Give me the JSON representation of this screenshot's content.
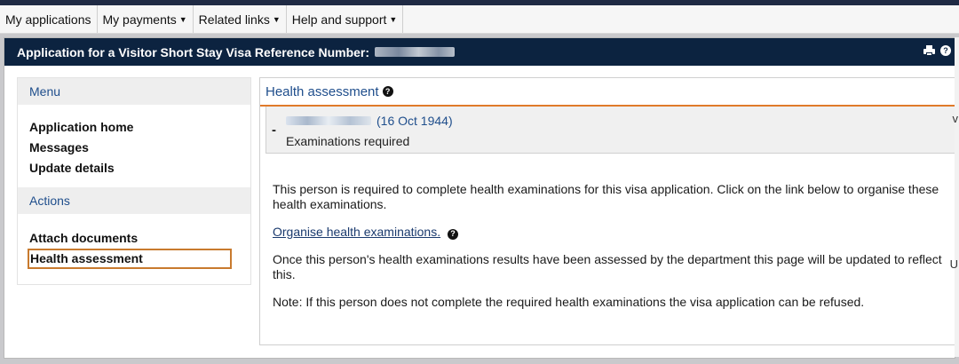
{
  "nav": {
    "my_applications": "My applications",
    "my_payments": "My payments",
    "related_links": "Related links",
    "help_support": "Help and support"
  },
  "window": {
    "title": "Application for a Visitor Short Stay Visa Reference Number:"
  },
  "sidebar": {
    "menu_heading": "Menu",
    "menu_items": [
      "Application home",
      "Messages",
      "Update details"
    ],
    "actions_heading": "Actions",
    "action_items": [
      "Attach documents",
      "Health assessment"
    ]
  },
  "content": {
    "title": "Health assessment",
    "person_dob": "(16 Oct 1944)",
    "person_dash": "-",
    "status": "Examinations required",
    "para1": "This person is required to complete health examinations for this visa application. Click on the link below to organise these health examinations.",
    "link_text": "Organise health examinations.",
    "para2": "Once this person's health examinations results have been assessed by the department this page will be updated to reflect this.",
    "para3": "Note: If this person does not complete the required health examinations the visa application can be refused."
  },
  "edge_letters": [
    "v",
    "U"
  ],
  "colors": {
    "title_bar": "#0c2340",
    "accent_orange": "#e07a2a",
    "link_blue": "#1f4e8c"
  }
}
